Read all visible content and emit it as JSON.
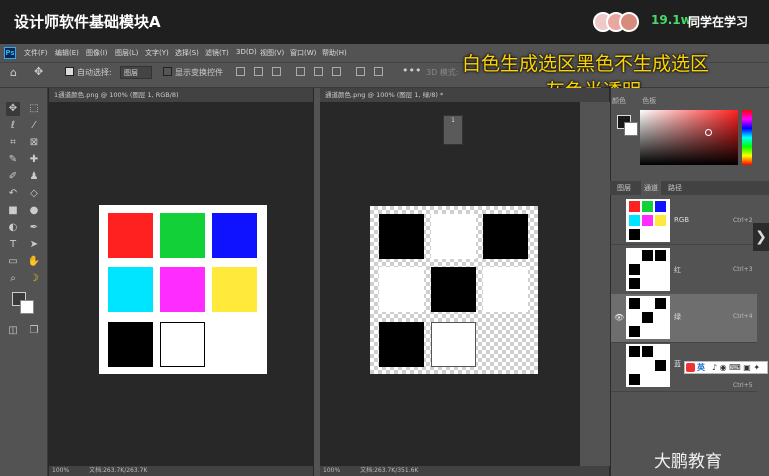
{
  "video": {
    "course_title": "设计师软件基础模块A",
    "viewer_count": "19.1w",
    "viewer_label": "同学在学习",
    "overlay_line1": "白色生成选区黑色不生成选区",
    "overlay_line2": "灰色半透明",
    "watermark": "大鹏教育"
  },
  "menu": [
    "文件(F)",
    "编辑(E)",
    "图像(I)",
    "图层(L)",
    "文字(Y)",
    "选择(S)",
    "滤镜(T)",
    "3D(D)",
    "视图(V)",
    "窗口(W)",
    "帮助(H)"
  ],
  "options": {
    "auto_select_label": "自动选择:",
    "layer_select": "图层",
    "show_transform_label": "显示变换控件",
    "three_d_mode": "3D 模式:"
  },
  "tabs": {
    "doc1": "1通道颜色.png @ 100% (图层 1, RGB/8)",
    "doc2": "通道颜色.png @ 100% (图层 1, 绿/8) *"
  },
  "status": {
    "doc1_zoom": "100%",
    "doc1_info": "文档:263.7K/263.7K",
    "doc2_zoom": "100%",
    "doc2_info": "文档:263.7K/351.6K"
  },
  "mini_panel_label": "1",
  "right_panel": {
    "picker_tabs": [
      "颜色",
      "色板"
    ],
    "channel_tabs": [
      "图层",
      "通道",
      "路径"
    ],
    "channels": [
      {
        "name": "RGB",
        "shortcut": "Ctrl+2"
      },
      {
        "name": "红",
        "shortcut": "Ctrl+3"
      },
      {
        "name": "绿",
        "shortcut": "Ctrl+4"
      },
      {
        "name": "蓝",
        "shortcut": "Ctrl+5"
      }
    ]
  },
  "ime_label": "英",
  "colors": {
    "red": "#ff2020",
    "green": "#12d138",
    "blue": "#0f12ff",
    "cyan": "#00e5ff",
    "magenta": "#ff2cff",
    "yellow": "#ffe93a",
    "black": "#000000",
    "white": "#ffffff",
    "accent": "#ffd400"
  }
}
